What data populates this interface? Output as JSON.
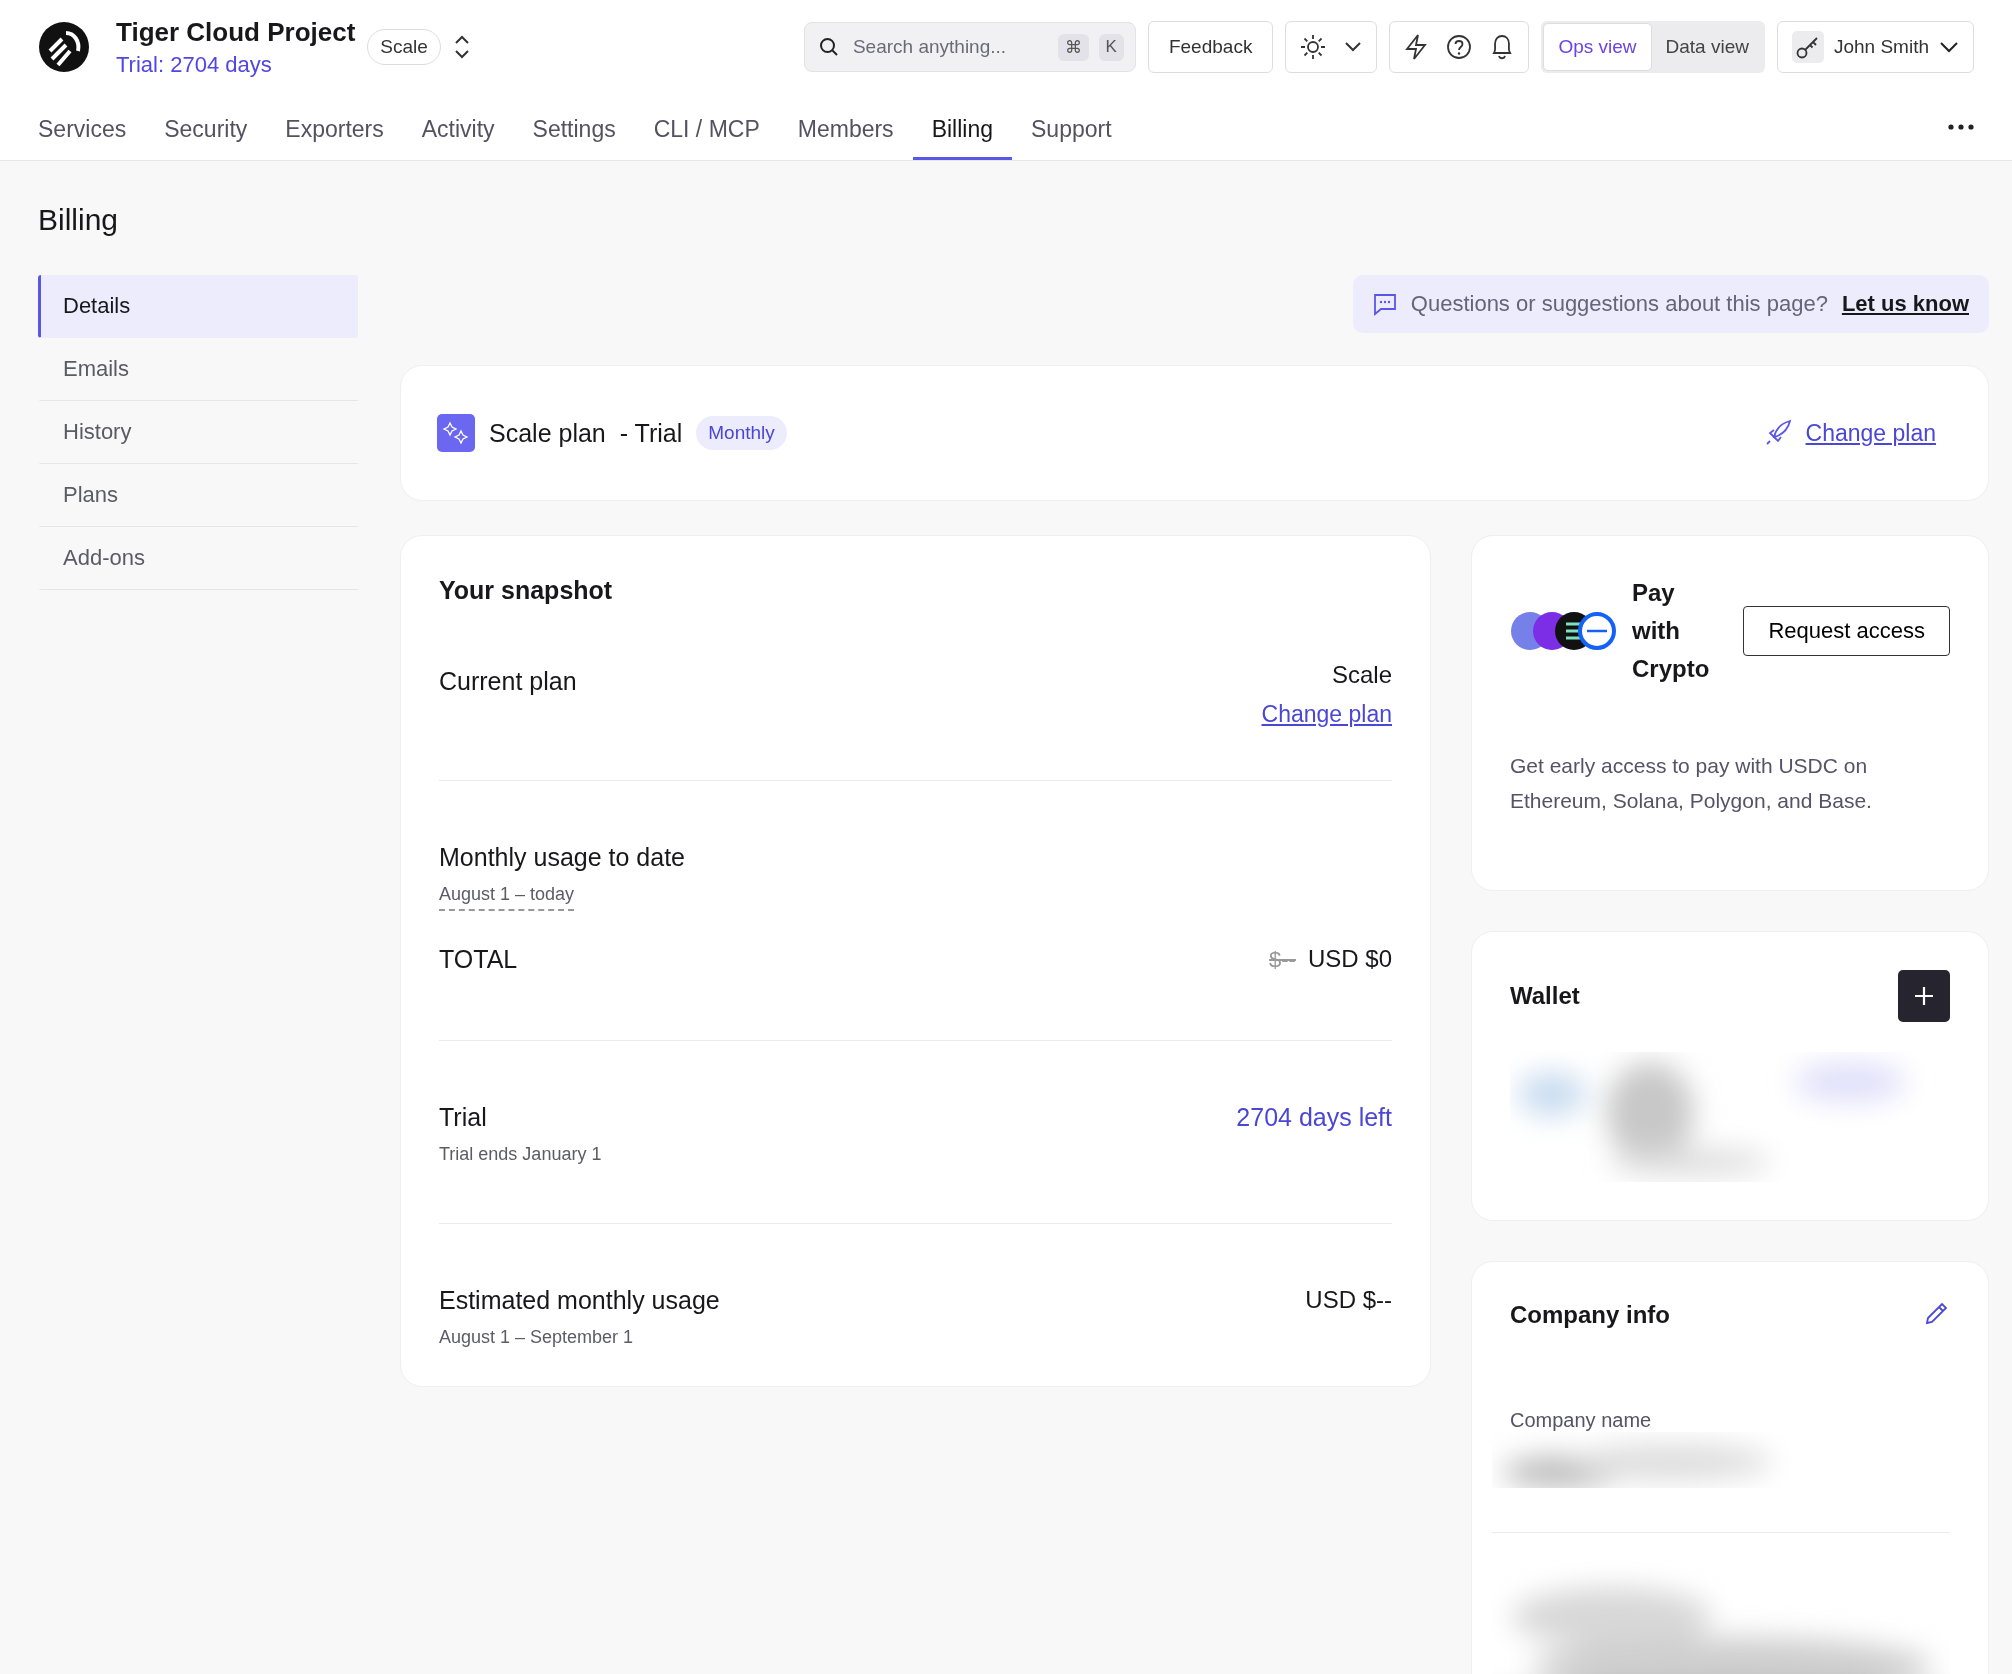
{
  "project": {
    "name": "Tiger Cloud Project",
    "trial": "Trial: 2704 days",
    "tier": "Scale"
  },
  "search": {
    "placeholder": "Search anything...",
    "keys": [
      "⌘",
      "K"
    ]
  },
  "feedback_button": "Feedback",
  "view_switch": [
    {
      "label": "Ops view",
      "selected": true
    },
    {
      "label": "Data view",
      "selected": false
    }
  ],
  "user": {
    "name": "John Smith"
  },
  "tabs": [
    {
      "label": "Services",
      "selected": false
    },
    {
      "label": "Security",
      "selected": false
    },
    {
      "label": "Exporters",
      "selected": false
    },
    {
      "label": "Activity",
      "selected": false
    },
    {
      "label": "Settings",
      "selected": false
    },
    {
      "label": "CLI / MCP",
      "selected": false
    },
    {
      "label": "Members",
      "selected": false
    },
    {
      "label": "Billing",
      "selected": true
    },
    {
      "label": "Support",
      "selected": false
    }
  ],
  "page_title": "Billing",
  "sidebar": {
    "items": [
      {
        "label": "Details",
        "selected": true
      },
      {
        "label": "Emails",
        "selected": false
      },
      {
        "label": "History",
        "selected": false
      },
      {
        "label": "Plans",
        "selected": false
      },
      {
        "label": "Add-ons",
        "selected": false
      }
    ]
  },
  "feedback_banner": {
    "text": "Questions or suggestions about this page?",
    "link": "Let us know"
  },
  "plan_card": {
    "name": "Scale plan",
    "suffix": "- Trial",
    "badge": "Monthly",
    "link": "Change plan"
  },
  "snapshot": {
    "title": "Your snapshot",
    "current_plan": {
      "label": "Current plan",
      "value": "Scale",
      "link": "Change plan"
    },
    "monthly_usage": {
      "label": "Monthly usage to date",
      "period": "August 1 – today"
    },
    "total": {
      "label": "TOTAL",
      "previous": "$--",
      "value": "USD $0"
    },
    "trial": {
      "label": "Trial",
      "note": "Trial ends January 1",
      "value": "2704 days left"
    },
    "estimated": {
      "label": "Estimated monthly usage",
      "period": "August 1 – September 1",
      "value": "USD $--"
    }
  },
  "crypto": {
    "title": "Pay with Crypto",
    "button": "Request access",
    "description": "Get early access to pay with USDC on Ethereum, Solana, Polygon, and Base."
  },
  "wallet": {
    "title": "Wallet"
  },
  "company": {
    "title": "Company info",
    "field_label": "Company name"
  }
}
